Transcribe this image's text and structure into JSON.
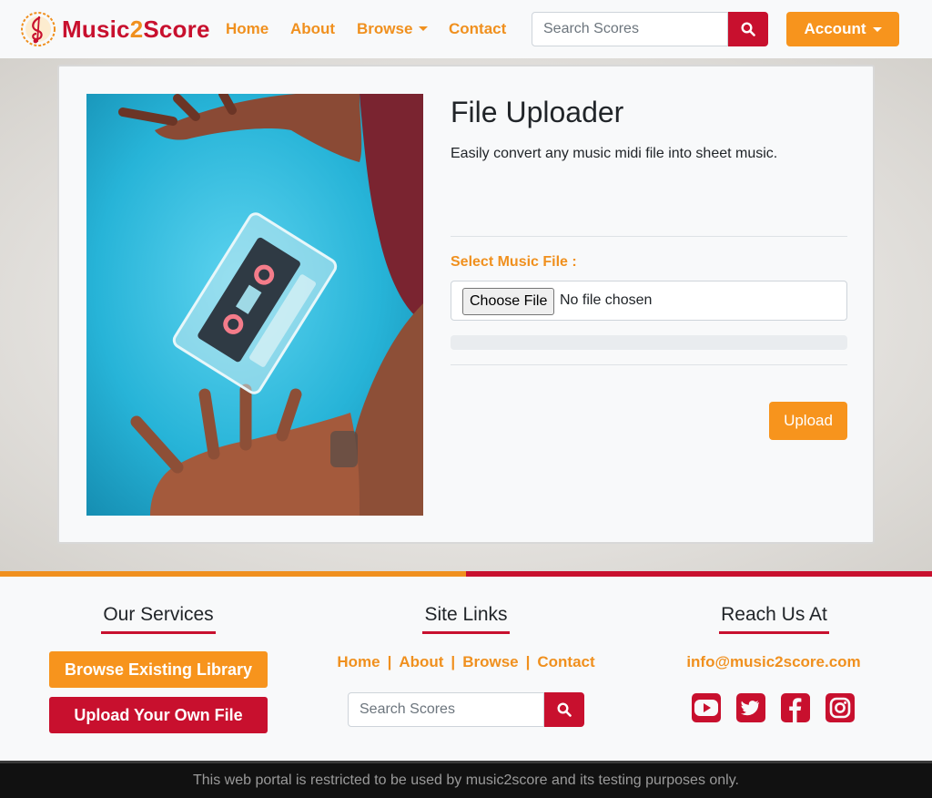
{
  "brand": {
    "part1": "Music",
    "part2": "2",
    "part3": "Score"
  },
  "nav": {
    "home": "Home",
    "about": "About",
    "browse": "Browse",
    "contact": "Contact"
  },
  "search": {
    "placeholder": "Search Scores"
  },
  "account": {
    "label": "Account"
  },
  "uploader": {
    "title": "File Uploader",
    "subtitle": "Easily convert any music midi file into sheet music.",
    "file_label": "Select Music File :",
    "choose_button": "Choose File",
    "no_file_text": "No file chosen",
    "upload_button": "Upload",
    "progress": 0
  },
  "footer": {
    "services": {
      "heading": "Our Services",
      "browse_library": "Browse Existing Library",
      "upload_file": "Upload Your Own File"
    },
    "links": {
      "heading": "Site Links",
      "home": "Home",
      "about": "About",
      "browse": "Browse",
      "contact": "Contact",
      "separator": "|"
    },
    "reach": {
      "heading": "Reach Us At",
      "email": "info@music2score.com",
      "social": [
        "youtube-icon",
        "twitter-icon",
        "facebook-icon",
        "instagram-icon"
      ]
    },
    "search_placeholder": "Search Scores"
  },
  "bottom_notice": "This web portal is restricted to be used by music2score and its testing purposes only.",
  "colors": {
    "orange": "#f7941d",
    "crimson": "#c8102e",
    "light": "#f8f9fa",
    "dark": "#111111"
  }
}
